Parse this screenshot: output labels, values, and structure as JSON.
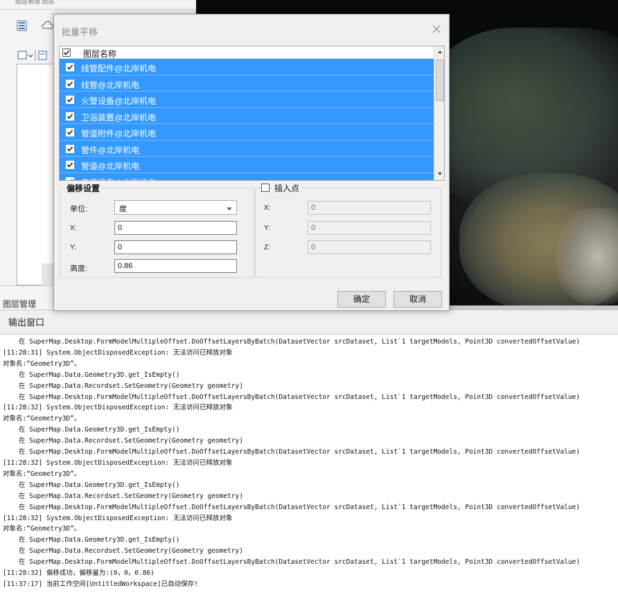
{
  "left_panel": {
    "top_strip_text": "图层管理 图层",
    "bottom_tab": "图层管理"
  },
  "output_window": {
    "title": "输出窗口",
    "log_lines": [
      "    在 SuperMap.Desktop.FormModelMultipleOffset.DoOffsetLayersByBatch(DatasetVector srcDataset, List`1 targetModels, Point3D convertedOffsetValue)",
      "[11:28:31] System.ObjectDisposedException: 无法访问已释放对象",
      "对象名:“Geometry3D”。",
      "    在 SuperMap.Data.Geometry3D.get_IsEmpty()",
      "    在 SuperMap.Data.Recordset.SetGeometry(Geometry geometry)",
      "    在 SuperMap.Desktop.FormModelMultipleOffset.DoOffsetLayersByBatch(DatasetVector srcDataset, List`1 targetModels, Point3D convertedOffsetValue)",
      "[11:28:32] System.ObjectDisposedException: 无法访问已释放对象",
      "对象名:“Geometry3D”。",
      "    在 SuperMap.Data.Geometry3D.get_IsEmpty()",
      "    在 SuperMap.Data.Recordset.SetGeometry(Geometry geometry)",
      "    在 SuperMap.Desktop.FormModelMultipleOffset.DoOffsetLayersByBatch(DatasetVector srcDataset, List`1 targetModels, Point3D convertedOffsetValue)",
      "[11:28:32] System.ObjectDisposedException: 无法访问已释放对象",
      "对象名:“Geometry3D”。",
      "    在 SuperMap.Data.Geometry3D.get_IsEmpty()",
      "    在 SuperMap.Data.Recordset.SetGeometry(Geometry geometry)",
      "    在 SuperMap.Desktop.FormModelMultipleOffset.DoOffsetLayersByBatch(DatasetVector srcDataset, List`1 targetModels, Point3D convertedOffsetValue)",
      "[11:28:32] System.ObjectDisposedException: 无法访问已释放对象",
      "对象名:“Geometry3D”。",
      "    在 SuperMap.Data.Geometry3D.get_IsEmpty()",
      "    在 SuperMap.Data.Recordset.SetGeometry(Geometry geometry)",
      "    在 SuperMap.Desktop.FormModelMultipleOffset.DoOffsetLayersByBatch(DatasetVector srcDataset, List`1 targetModels, Point3D convertedOffsetValue)",
      "[11:28:32] 偏移成功，偏移量为:(0，0，0.86)",
      "[11:37:17] 当前工作空间[UntitledWorkspace]已自动保存!"
    ]
  },
  "dialog": {
    "title": "批量平移",
    "layer_list": {
      "header": "图层名称",
      "header_checked": true,
      "items": [
        {
          "label": "线管配件@北岸机电",
          "checked": true
        },
        {
          "label": "线管@北岸机电",
          "checked": true
        },
        {
          "label": "火警设备@北岸机电",
          "checked": true
        },
        {
          "label": "卫浴装置@北岸机电",
          "checked": true
        },
        {
          "label": "管道附件@北岸机电",
          "checked": true
        },
        {
          "label": "管件@北岸机电",
          "checked": true
        },
        {
          "label": "管道@北岸机电",
          "checked": true
        },
        {
          "label": "专用设备@北岸机电",
          "checked": true
        }
      ]
    },
    "offset": {
      "title": "偏移设置",
      "unit_label": "单位:",
      "unit_value": "度",
      "x_label": "X:",
      "x_value": "0",
      "y_label": "Y:",
      "y_value": "0",
      "height_label": "高度:",
      "height_value": "0.86"
    },
    "insert_point": {
      "title": "插入点",
      "checked": false,
      "x_label": "X:",
      "x_value": "0",
      "y_label": "Y:",
      "y_value": "0",
      "z_label": "Z:",
      "z_value": "0"
    },
    "ok_label": "确定",
    "cancel_label": "取消"
  },
  "colors": {
    "selection": "#3399ff",
    "dialog_bg": "#f0f0f0",
    "map_bg": "#07090c"
  }
}
